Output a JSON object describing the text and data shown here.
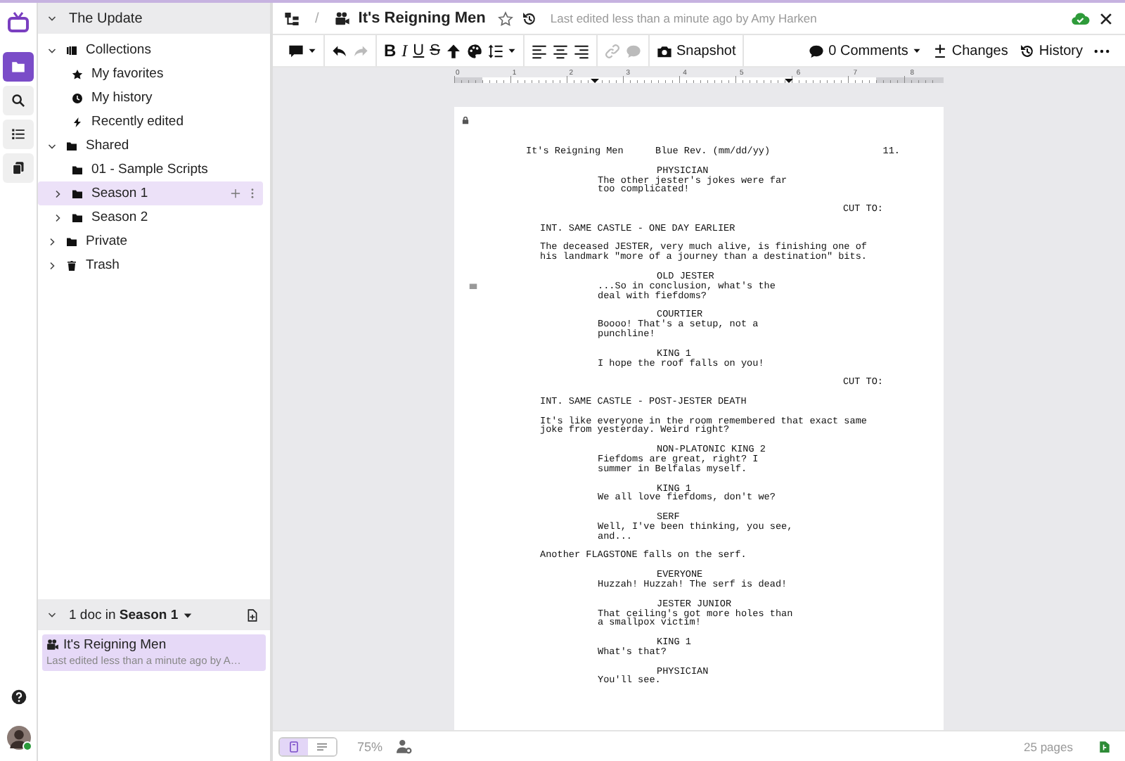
{
  "rail": {
    "items": [
      {
        "kind": "library",
        "selected": true
      },
      {
        "kind": "search",
        "selected": false
      },
      {
        "kind": "outline",
        "selected": false
      },
      {
        "kind": "copies",
        "selected": false
      }
    ],
    "user_online": true
  },
  "sidebar": {
    "title": "The Update",
    "expanded": true,
    "tree": [
      {
        "kind": "collections",
        "label": "Collections",
        "expanded": true,
        "selected": false,
        "children": [
          {
            "kind": "favorites",
            "label": "My favorites",
            "selected": false
          },
          {
            "kind": "history",
            "label": "My history",
            "selected": false
          },
          {
            "kind": "recent",
            "label": "Recently edited",
            "selected": false
          }
        ]
      },
      {
        "kind": "folder",
        "label": "Shared",
        "expanded": true,
        "selected": false,
        "children": [
          {
            "kind": "folder",
            "label": "01 - Sample Scripts",
            "selected": false
          },
          {
            "kind": "folder",
            "label": "Season 1",
            "expanded": false,
            "selected": true
          },
          {
            "kind": "folder",
            "label": "Season 2",
            "expanded": false,
            "selected": false
          }
        ]
      },
      {
        "kind": "folder",
        "label": "Private",
        "expanded": false,
        "selected": false
      },
      {
        "kind": "trash",
        "label": "Trash",
        "expanded": false,
        "selected": false
      }
    ],
    "docs_panel": {
      "expanded": true,
      "heading": "1 doc in **Season 1**",
      "docs": [
        {
          "title": "It's Reigning Men",
          "subtitle": "Last edited less than a minute ago by A…",
          "selected": true
        }
      ]
    }
  },
  "header": {
    "separator": "/",
    "title": "It's Reigning Men",
    "starred": false,
    "last_edited": "Last edited less than a minute ago by Amy Harken"
  },
  "toolbar": {
    "groups": [
      [
        {
          "kind": "comment-menu",
          "disabled": false
        }
      ],
      [
        {
          "kind": "undo",
          "disabled": false
        },
        {
          "kind": "redo",
          "disabled": true
        }
      ],
      [
        {
          "kind": "bold",
          "label": "B",
          "disabled": false
        },
        {
          "kind": "italic",
          "label": "I",
          "disabled": false
        },
        {
          "kind": "underline",
          "label": "U",
          "disabled": false
        },
        {
          "kind": "strike",
          "label": "S",
          "disabled": false
        },
        {
          "kind": "raise",
          "disabled": false
        },
        {
          "kind": "palette",
          "disabled": false
        },
        {
          "kind": "line-spacing",
          "disabled": false
        }
      ],
      [
        {
          "kind": "align-left",
          "disabled": false
        },
        {
          "kind": "align-center",
          "disabled": false
        },
        {
          "kind": "align-right",
          "disabled": false
        }
      ],
      [
        {
          "kind": "link",
          "disabled": true
        },
        {
          "kind": "bubble",
          "disabled": true
        }
      ],
      [
        {
          "kind": "snapshot",
          "label": "Snapshot",
          "disabled": false
        }
      ]
    ],
    "right": [
      {
        "kind": "comments",
        "label": "0 Comments"
      },
      {
        "kind": "changes",
        "label": "Changes"
      },
      {
        "kind": "history",
        "label": "History"
      },
      {
        "kind": "more"
      }
    ]
  },
  "ruler": {
    "marks": [
      "0",
      "1",
      "2",
      "3",
      "4",
      "5",
      "6",
      "7",
      "8"
    ]
  },
  "script": {
    "locked": true,
    "header": {
      "title": "It's Reigning Men",
      "revision": "Blue Rev. (mm/dd/yy)",
      "page_number": "11."
    },
    "elements": [
      {
        "kind": "character",
        "lines": [
          "PHYSICIAN"
        ],
        "comment": false
      },
      {
        "kind": "dialogue",
        "lines": [
          "The other jester's jokes were far",
          "too complicated!"
        ],
        "comment": false
      },
      {
        "kind": "transition",
        "lines": [
          "CUT TO:"
        ],
        "comment": false
      },
      {
        "kind": "scene",
        "lines": [
          "INT. SAME CASTLE - ONE DAY EARLIER"
        ],
        "comment": false
      },
      {
        "kind": "action",
        "lines": [
          "The deceased JESTER, very much alive, is finishing one of",
          "his landmark \"more of a journey than a destination\" bits."
        ],
        "comment": false
      },
      {
        "kind": "character",
        "lines": [
          "OLD JESTER"
        ],
        "comment": false
      },
      {
        "kind": "dialogue",
        "lines": [
          "...So in conclusion, what's the",
          "deal with fiefdoms?"
        ],
        "comment": true
      },
      {
        "kind": "character",
        "lines": [
          "COURTIER"
        ],
        "comment": false
      },
      {
        "kind": "dialogue",
        "lines": [
          "Boooo! That's a setup, not a",
          "punchline!"
        ],
        "comment": false
      },
      {
        "kind": "character",
        "lines": [
          "KING 1"
        ],
        "comment": false
      },
      {
        "kind": "dialogue",
        "lines": [
          "I hope the roof falls on you!"
        ],
        "comment": false
      },
      {
        "kind": "transition",
        "lines": [
          "CUT TO:"
        ],
        "comment": false
      },
      {
        "kind": "scene",
        "lines": [
          "INT. SAME CASTLE - POST-JESTER DEATH"
        ],
        "comment": false
      },
      {
        "kind": "action",
        "lines": [
          "It's like everyone in the room remembered that exact same",
          "joke from yesterday. Weird right?"
        ],
        "comment": false
      },
      {
        "kind": "character",
        "lines": [
          "NON-PLATONIC KING 2"
        ],
        "comment": false
      },
      {
        "kind": "dialogue",
        "lines": [
          "Fiefdoms are great, right? I",
          "summer in Belfalas myself."
        ],
        "comment": false
      },
      {
        "kind": "character",
        "lines": [
          "KING 1"
        ],
        "comment": false
      },
      {
        "kind": "dialogue",
        "lines": [
          "We all love fiefdoms, don't we?"
        ],
        "comment": false
      },
      {
        "kind": "character",
        "lines": [
          "SERF"
        ],
        "comment": false
      },
      {
        "kind": "dialogue",
        "lines": [
          "Well, I've been thinking, you see,",
          "and..."
        ],
        "comment": false
      },
      {
        "kind": "action",
        "lines": [
          "Another FLAGSTONE falls on the serf."
        ],
        "comment": false
      },
      {
        "kind": "character",
        "lines": [
          "EVERYONE"
        ],
        "comment": false
      },
      {
        "kind": "dialogue",
        "lines": [
          "Huzzah! Huzzah! The serf is dead!"
        ],
        "comment": false
      },
      {
        "kind": "character",
        "lines": [
          "JESTER JUNIOR"
        ],
        "comment": false
      },
      {
        "kind": "dialogue",
        "lines": [
          "That ceiling's got more holes than",
          "a smallpox victim!"
        ],
        "comment": false
      },
      {
        "kind": "character",
        "lines": [
          "KING 1"
        ],
        "comment": false
      },
      {
        "kind": "dialogue",
        "lines": [
          "What's that?"
        ],
        "comment": false
      },
      {
        "kind": "character",
        "lines": [
          "PHYSICIAN"
        ],
        "comment": false
      },
      {
        "kind": "dialogue",
        "lines": [
          "You'll see."
        ],
        "comment": false
      }
    ]
  },
  "status_bar": {
    "views": [
      {
        "kind": "page",
        "selected": true
      },
      {
        "kind": "text",
        "selected": false
      }
    ],
    "zoom": "75%",
    "pages": "25 pages"
  }
}
